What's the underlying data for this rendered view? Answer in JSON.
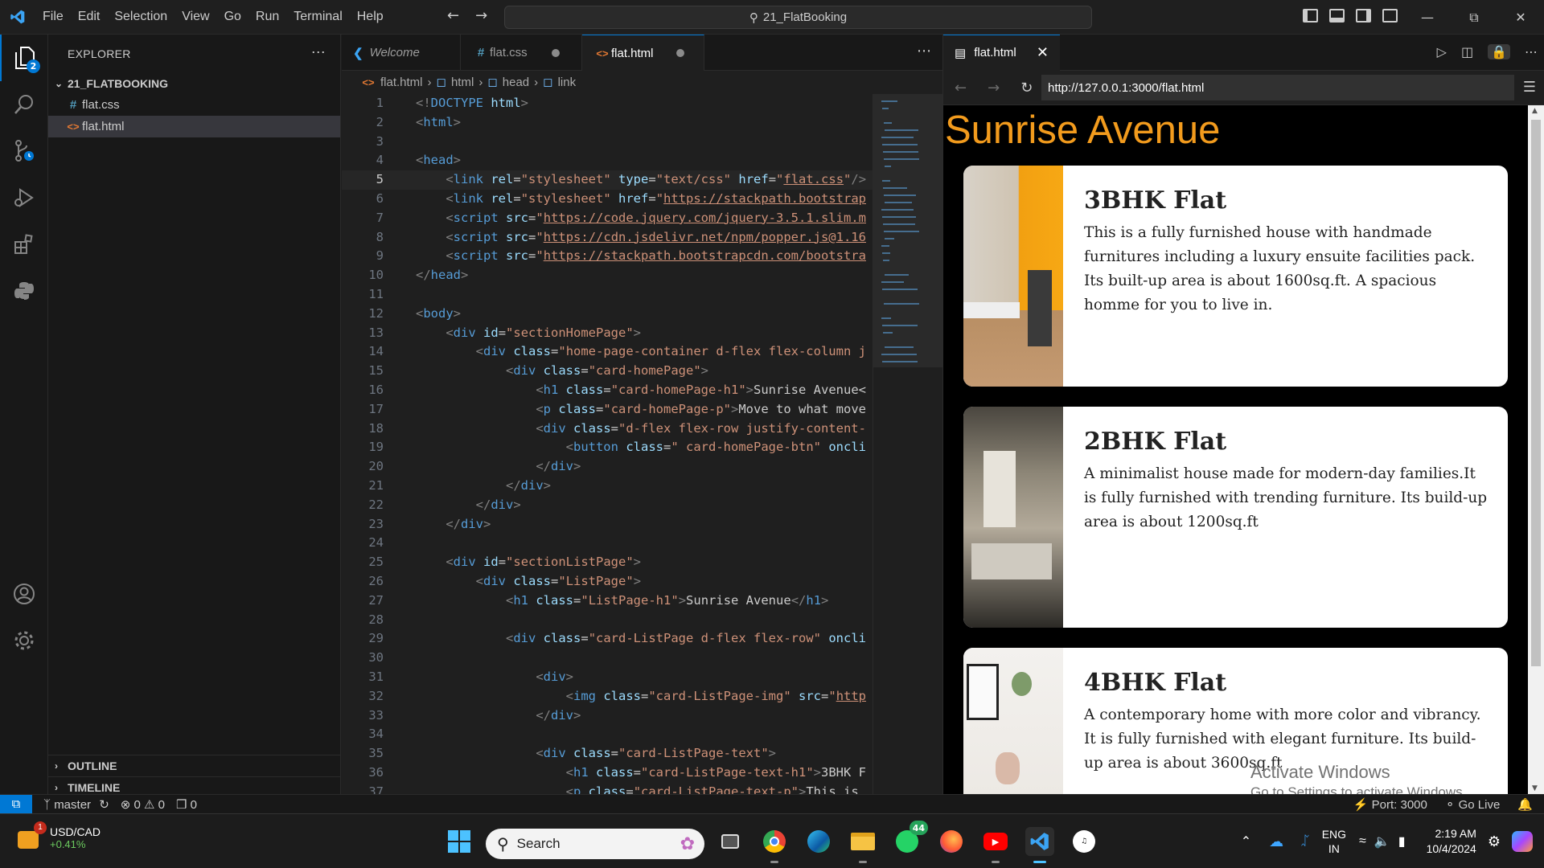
{
  "titlebar": {
    "menu": [
      "File",
      "Edit",
      "Selection",
      "View",
      "Go",
      "Run",
      "Terminal",
      "Help"
    ],
    "command_center": "21_FlatBooking"
  },
  "activity": {
    "scm_badge": "2"
  },
  "sidebar": {
    "title": "EXPLORER",
    "folder": "21_FLATBOOKING",
    "files": [
      "flat.css",
      "flat.html"
    ],
    "outline": "OUTLINE",
    "timeline": "TIMELINE"
  },
  "editor": {
    "tabs": [
      "Welcome",
      "flat.css",
      "flat.html"
    ],
    "breadcrumb": [
      "flat.html",
      "html",
      "head",
      "link"
    ],
    "lines": [
      {
        "n": "1",
        "code": [
          [
            "pt",
            "<!"
          ],
          [
            "tg",
            "DOCTYPE"
          ],
          [
            "tx",
            " "
          ],
          [
            "at",
            "html"
          ],
          [
            "pt",
            ">"
          ]
        ]
      },
      {
        "n": "2",
        "code": [
          [
            "pt",
            "<"
          ],
          [
            "tg",
            "html"
          ],
          [
            "pt",
            ">"
          ]
        ]
      },
      {
        "n": "3",
        "code": []
      },
      {
        "n": "4",
        "code": [
          [
            "pt",
            "<"
          ],
          [
            "tg",
            "head"
          ],
          [
            "pt",
            ">"
          ]
        ]
      },
      {
        "n": "5",
        "code": [
          [
            "tx",
            "    "
          ],
          [
            "pt",
            "<"
          ],
          [
            "tg",
            "link"
          ],
          [
            "tx",
            " "
          ],
          [
            "at",
            "rel"
          ],
          [
            "tx",
            "="
          ],
          [
            "st",
            "\"stylesheet\""
          ],
          [
            "tx",
            " "
          ],
          [
            "at",
            "type"
          ],
          [
            "tx",
            "="
          ],
          [
            "st",
            "\"text/css\""
          ],
          [
            "tx",
            " "
          ],
          [
            "at",
            "href"
          ],
          [
            "tx",
            "="
          ],
          [
            "st",
            "\""
          ],
          [
            "stu",
            "flat.css"
          ],
          [
            "st",
            "\""
          ],
          [
            "pt",
            "/>"
          ]
        ]
      },
      {
        "n": "6",
        "code": [
          [
            "tx",
            "    "
          ],
          [
            "pt",
            "<"
          ],
          [
            "tg",
            "link"
          ],
          [
            "tx",
            " "
          ],
          [
            "at",
            "rel"
          ],
          [
            "tx",
            "="
          ],
          [
            "st",
            "\"stylesheet\""
          ],
          [
            "tx",
            " "
          ],
          [
            "at",
            "href"
          ],
          [
            "tx",
            "="
          ],
          [
            "st",
            "\""
          ],
          [
            "stu",
            "https://stackpath.bootstrap"
          ]
        ]
      },
      {
        "n": "7",
        "code": [
          [
            "tx",
            "    "
          ],
          [
            "pt",
            "<"
          ],
          [
            "tg",
            "script"
          ],
          [
            "tx",
            " "
          ],
          [
            "at",
            "src"
          ],
          [
            "tx",
            "="
          ],
          [
            "st",
            "\""
          ],
          [
            "stu",
            "https://code.jquery.com/jquery-3.5.1.slim.m"
          ]
        ]
      },
      {
        "n": "8",
        "code": [
          [
            "tx",
            "    "
          ],
          [
            "pt",
            "<"
          ],
          [
            "tg",
            "script"
          ],
          [
            "tx",
            " "
          ],
          [
            "at",
            "src"
          ],
          [
            "tx",
            "="
          ],
          [
            "st",
            "\""
          ],
          [
            "stu",
            "https://cdn.jsdelivr.net/npm/popper.js@1.16"
          ]
        ]
      },
      {
        "n": "9",
        "code": [
          [
            "tx",
            "    "
          ],
          [
            "pt",
            "<"
          ],
          [
            "tg",
            "script"
          ],
          [
            "tx",
            " "
          ],
          [
            "at",
            "src"
          ],
          [
            "tx",
            "="
          ],
          [
            "st",
            "\""
          ],
          [
            "stu",
            "https://stackpath.bootstrapcdn.com/bootstra"
          ]
        ]
      },
      {
        "n": "10",
        "code": [
          [
            "pt",
            "</"
          ],
          [
            "tg",
            "head"
          ],
          [
            "pt",
            ">"
          ]
        ]
      },
      {
        "n": "11",
        "code": []
      },
      {
        "n": "12",
        "code": [
          [
            "pt",
            "<"
          ],
          [
            "tg",
            "body"
          ],
          [
            "pt",
            ">"
          ]
        ]
      },
      {
        "n": "13",
        "code": [
          [
            "tx",
            "    "
          ],
          [
            "pt",
            "<"
          ],
          [
            "tg",
            "div"
          ],
          [
            "tx",
            " "
          ],
          [
            "at",
            "id"
          ],
          [
            "tx",
            "="
          ],
          [
            "st",
            "\"sectionHomePage\""
          ],
          [
            "pt",
            ">"
          ]
        ]
      },
      {
        "n": "14",
        "code": [
          [
            "tx",
            "        "
          ],
          [
            "pt",
            "<"
          ],
          [
            "tg",
            "div"
          ],
          [
            "tx",
            " "
          ],
          [
            "at",
            "class"
          ],
          [
            "tx",
            "="
          ],
          [
            "st",
            "\"home-page-container d-flex flex-column j"
          ]
        ]
      },
      {
        "n": "15",
        "code": [
          [
            "tx",
            "            "
          ],
          [
            "pt",
            "<"
          ],
          [
            "tg",
            "div"
          ],
          [
            "tx",
            " "
          ],
          [
            "at",
            "class"
          ],
          [
            "tx",
            "="
          ],
          [
            "st",
            "\"card-homePage\""
          ],
          [
            "pt",
            ">"
          ]
        ]
      },
      {
        "n": "16",
        "code": [
          [
            "tx",
            "                "
          ],
          [
            "pt",
            "<"
          ],
          [
            "tg",
            "h1"
          ],
          [
            "tx",
            " "
          ],
          [
            "at",
            "class"
          ],
          [
            "tx",
            "="
          ],
          [
            "st",
            "\"card-homePage-h1\""
          ],
          [
            "pt",
            ">"
          ],
          [
            "tx",
            "Sunrise Avenue<"
          ]
        ]
      },
      {
        "n": "17",
        "code": [
          [
            "tx",
            "                "
          ],
          [
            "pt",
            "<"
          ],
          [
            "tg",
            "p"
          ],
          [
            "tx",
            " "
          ],
          [
            "at",
            "class"
          ],
          [
            "tx",
            "="
          ],
          [
            "st",
            "\"card-homePage-p\""
          ],
          [
            "pt",
            ">"
          ],
          [
            "tx",
            "Move to what move"
          ]
        ]
      },
      {
        "n": "18",
        "code": [
          [
            "tx",
            "                "
          ],
          [
            "pt",
            "<"
          ],
          [
            "tg",
            "div"
          ],
          [
            "tx",
            " "
          ],
          [
            "at",
            "class"
          ],
          [
            "tx",
            "="
          ],
          [
            "st",
            "\"d-flex flex-row justify-content-"
          ]
        ]
      },
      {
        "n": "19",
        "code": [
          [
            "tx",
            "                    "
          ],
          [
            "pt",
            "<"
          ],
          [
            "tg",
            "button"
          ],
          [
            "tx",
            " "
          ],
          [
            "at",
            "class"
          ],
          [
            "tx",
            "="
          ],
          [
            "st",
            "\" card-homePage-btn\""
          ],
          [
            "tx",
            " "
          ],
          [
            "at",
            "oncli"
          ]
        ]
      },
      {
        "n": "20",
        "code": [
          [
            "tx",
            "                "
          ],
          [
            "pt",
            "</"
          ],
          [
            "tg",
            "div"
          ],
          [
            "pt",
            ">"
          ]
        ]
      },
      {
        "n": "21",
        "code": [
          [
            "tx",
            "            "
          ],
          [
            "pt",
            "</"
          ],
          [
            "tg",
            "div"
          ],
          [
            "pt",
            ">"
          ]
        ]
      },
      {
        "n": "22",
        "code": [
          [
            "tx",
            "        "
          ],
          [
            "pt",
            "</"
          ],
          [
            "tg",
            "div"
          ],
          [
            "pt",
            ">"
          ]
        ]
      },
      {
        "n": "23",
        "code": [
          [
            "tx",
            "    "
          ],
          [
            "pt",
            "</"
          ],
          [
            "tg",
            "div"
          ],
          [
            "pt",
            ">"
          ]
        ]
      },
      {
        "n": "24",
        "code": []
      },
      {
        "n": "25",
        "code": [
          [
            "tx",
            "    "
          ],
          [
            "pt",
            "<"
          ],
          [
            "tg",
            "div"
          ],
          [
            "tx",
            " "
          ],
          [
            "at",
            "id"
          ],
          [
            "tx",
            "="
          ],
          [
            "st",
            "\"sectionListPage\""
          ],
          [
            "pt",
            ">"
          ]
        ]
      },
      {
        "n": "26",
        "code": [
          [
            "tx",
            "        "
          ],
          [
            "pt",
            "<"
          ],
          [
            "tg",
            "div"
          ],
          [
            "tx",
            " "
          ],
          [
            "at",
            "class"
          ],
          [
            "tx",
            "="
          ],
          [
            "st",
            "\"ListPage\""
          ],
          [
            "pt",
            ">"
          ]
        ]
      },
      {
        "n": "27",
        "code": [
          [
            "tx",
            "            "
          ],
          [
            "pt",
            "<"
          ],
          [
            "tg",
            "h1"
          ],
          [
            "tx",
            " "
          ],
          [
            "at",
            "class"
          ],
          [
            "tx",
            "="
          ],
          [
            "st",
            "\"ListPage-h1\""
          ],
          [
            "pt",
            ">"
          ],
          [
            "tx",
            "Sunrise Avenue"
          ],
          [
            "pt",
            "</"
          ],
          [
            "tg",
            "h1"
          ],
          [
            "pt",
            ">"
          ]
        ]
      },
      {
        "n": "28",
        "code": []
      },
      {
        "n": "29",
        "code": [
          [
            "tx",
            "            "
          ],
          [
            "pt",
            "<"
          ],
          [
            "tg",
            "div"
          ],
          [
            "tx",
            " "
          ],
          [
            "at",
            "class"
          ],
          [
            "tx",
            "="
          ],
          [
            "st",
            "\"card-ListPage d-flex flex-row\""
          ],
          [
            "tx",
            " "
          ],
          [
            "at",
            "oncli"
          ]
        ]
      },
      {
        "n": "30",
        "code": []
      },
      {
        "n": "31",
        "code": [
          [
            "tx",
            "                "
          ],
          [
            "pt",
            "<"
          ],
          [
            "tg",
            "div"
          ],
          [
            "pt",
            ">"
          ]
        ]
      },
      {
        "n": "32",
        "code": [
          [
            "tx",
            "                    "
          ],
          [
            "pt",
            "<"
          ],
          [
            "tg",
            "img"
          ],
          [
            "tx",
            " "
          ],
          [
            "at",
            "class"
          ],
          [
            "tx",
            "="
          ],
          [
            "st",
            "\"card-ListPage-img\""
          ],
          [
            "tx",
            " "
          ],
          [
            "at",
            "src"
          ],
          [
            "tx",
            "="
          ],
          [
            "st",
            "\""
          ],
          [
            "stu",
            "http"
          ]
        ]
      },
      {
        "n": "33",
        "code": [
          [
            "tx",
            "                "
          ],
          [
            "pt",
            "</"
          ],
          [
            "tg",
            "div"
          ],
          [
            "pt",
            ">"
          ]
        ]
      },
      {
        "n": "34",
        "code": []
      },
      {
        "n": "35",
        "code": [
          [
            "tx",
            "                "
          ],
          [
            "pt",
            "<"
          ],
          [
            "tg",
            "div"
          ],
          [
            "tx",
            " "
          ],
          [
            "at",
            "class"
          ],
          [
            "tx",
            "="
          ],
          [
            "st",
            "\"card-ListPage-text\""
          ],
          [
            "pt",
            ">"
          ]
        ]
      },
      {
        "n": "36",
        "code": [
          [
            "tx",
            "                    "
          ],
          [
            "pt",
            "<"
          ],
          [
            "tg",
            "h1"
          ],
          [
            "tx",
            " "
          ],
          [
            "at",
            "class"
          ],
          [
            "tx",
            "="
          ],
          [
            "st",
            "\"card-ListPage-text-h1\""
          ],
          [
            "pt",
            ">"
          ],
          [
            "tx",
            "3BHK F"
          ]
        ]
      },
      {
        "n": "37",
        "code": [
          [
            "tx",
            "                    "
          ],
          [
            "pt",
            "<"
          ],
          [
            "tg",
            "p"
          ],
          [
            "tx",
            " "
          ],
          [
            "at",
            "class"
          ],
          [
            "tx",
            "="
          ],
          [
            "st",
            "\"card-ListPage-text-p\""
          ],
          [
            "pt",
            ">"
          ],
          [
            "tx",
            "This is"
          ]
        ]
      }
    ]
  },
  "preview": {
    "tab": "flat.html",
    "url": "http://127.0.0.1:3000/flat.html",
    "heading": "Sunrise Avenue",
    "cards": [
      {
        "title": "3BHK Flat",
        "text": "This is a fully furnished house with handmade furnitures including a luxury ensuite facilities pack. Its built-up area is about 1600sq.ft. A spacious homme for you to live in."
      },
      {
        "title": "2BHK Flat",
        "text": "A minimalist house made for modern-day families.It is fully furnished with trending furniture. Its build-up area is about 1200sq.ft"
      },
      {
        "title": "4BHK Flat",
        "text": "A contemporary home with more color and vibrancy. It is fully furnished with elegant furniture. Its build-up area is about 3600sq.ft"
      }
    ],
    "watermark_title": "Activate Windows",
    "watermark_sub": "Go to Settings to activate Windows."
  },
  "status": {
    "branch": "master",
    "errors": "0",
    "warnings": "0",
    "ports": "0",
    "port": "Port: 3000",
    "golive": "Go Live"
  },
  "taskbar": {
    "ticker_name": "USD/CAD",
    "ticker_change": "+0.41%",
    "ticker_badge": "1",
    "search": "Search",
    "whatsapp_badge": "44",
    "lang1": "ENG",
    "lang2": "IN",
    "time": "2:19 AM",
    "date": "10/4/2024"
  }
}
